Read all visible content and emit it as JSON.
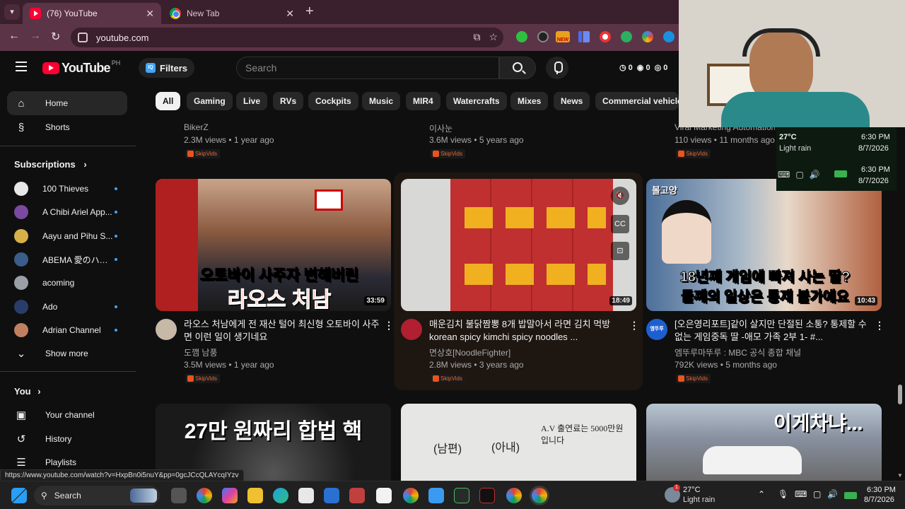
{
  "browser": {
    "tabs": [
      {
        "title": "(76) YouTube",
        "active": true
      },
      {
        "title": "New Tab",
        "active": false
      }
    ],
    "url": "youtube.com",
    "extension_badge": "NEW"
  },
  "header": {
    "logo_text": "YouTube",
    "region": "PH",
    "filters_label": "Filters",
    "filters_icon_text": "IQ",
    "search_placeholder": "Search",
    "stats": [
      "0",
      "0",
      "0"
    ]
  },
  "sidebar": {
    "main": [
      {
        "label": "Home",
        "icon": "home-icon",
        "active": true
      },
      {
        "label": "Shorts",
        "icon": "shorts-icon",
        "active": false
      }
    ],
    "subscriptions_title": "Subscriptions",
    "subscriptions": [
      {
        "name": "100 Thieves",
        "color": "#e8e8e8"
      },
      {
        "name": "A Chibi Ariel App...",
        "color": "#7a4aa0"
      },
      {
        "name": "Aayu and Pihu S...",
        "color": "#d8b048"
      },
      {
        "name": "ABEMA 愛のハイ...",
        "color": "#3a5d8a"
      },
      {
        "name": "acoming",
        "color": "#9aa0a6"
      },
      {
        "name": "Ado",
        "color": "#2a3d6a"
      },
      {
        "name": "Adrian Channel",
        "color": "#c08060"
      }
    ],
    "show_more": "Show more",
    "you_title": "You",
    "you_items": [
      {
        "label": "Your channel",
        "icon": "channel-icon"
      },
      {
        "label": "History",
        "icon": "history-icon"
      },
      {
        "label": "Playlists",
        "icon": "playlists-icon"
      }
    ]
  },
  "chips": [
    "All",
    "Gaming",
    "Live",
    "RVs",
    "Cockpits",
    "Music",
    "MIR4",
    "Watercrafts",
    "Mixes",
    "News",
    "Commercial vehicles"
  ],
  "skipvids_label": "SkipVids",
  "top_row": [
    {
      "channel": "BikerZ",
      "meta": "2.3M views • 1 year ago"
    },
    {
      "channel": "이사눈",
      "meta": "3.6M views • 5 years ago"
    },
    {
      "channel": "Viral Marketing Automation",
      "meta": "110 views • 11 months ago"
    }
  ],
  "videos": [
    {
      "title": "라오스 처남에게 전 재산 털어 최신형 오토바이 사주면 이런 일이 생기네요",
      "channel": "도깸 남풍",
      "meta": "3.5M views • 1 year ago",
      "duration": "33:59",
      "thumb_caption_1": "오토바이 사주자 변해버린",
      "thumb_caption_2": "라오스 처남",
      "avatar_color": "#c8b8a8"
    },
    {
      "title": "매운김치 불닭짬뽕 8개 밥말아서 라면 김치 먹방 korean spicy kimchi spicy noodles ...",
      "channel": "면상호[NoodleFighter]",
      "meta": "2.8M views • 3 years ago",
      "duration": "18:49",
      "avatar_color": "#b02030"
    },
    {
      "title": "[오은영리포트]같이 살지만 단절된 소통? 통제할 수 없는 게임중독 딸 -애모 가족 2부 1- #...",
      "channel": "엠뚜루마뚜루 : MBC 공식 종합 채널",
      "meta": "792K views • 5 months ago",
      "duration": "10:43",
      "thumb_caption_1": "18년째 게임에 빠져 사는 딸?",
      "thumb_caption_2": "둘째의 일상은 통제 불가예요",
      "thumb_tag": "볼고양",
      "avatar_color": "#1e5fd0",
      "avatar_text": "엠뚜루"
    }
  ],
  "bottom_row": [
    {
      "caption": "27만 원짜리 합법 핵"
    },
    {
      "caption_1": "(남편)",
      "caption_2": "(아내)",
      "caption_3": "A.V 출연료는 5000만원 입니다"
    },
    {
      "caption": "이게차냐..."
    }
  ],
  "status_url": "https://www.youtube.com/watch?v=HxpBn0i5nuY&pp=0gcJCcQLAYcqIYzv",
  "weather_widget": {
    "temp": "27°C",
    "condition": "Light rain",
    "time": "6:30 PM",
    "date": "8/7/2026"
  },
  "taskbar": {
    "search_label": "Search",
    "temp": "27°C",
    "condition": "Light rain",
    "time": "6:30 PM",
    "date": "8/7/2026",
    "weather_badge": "1"
  }
}
